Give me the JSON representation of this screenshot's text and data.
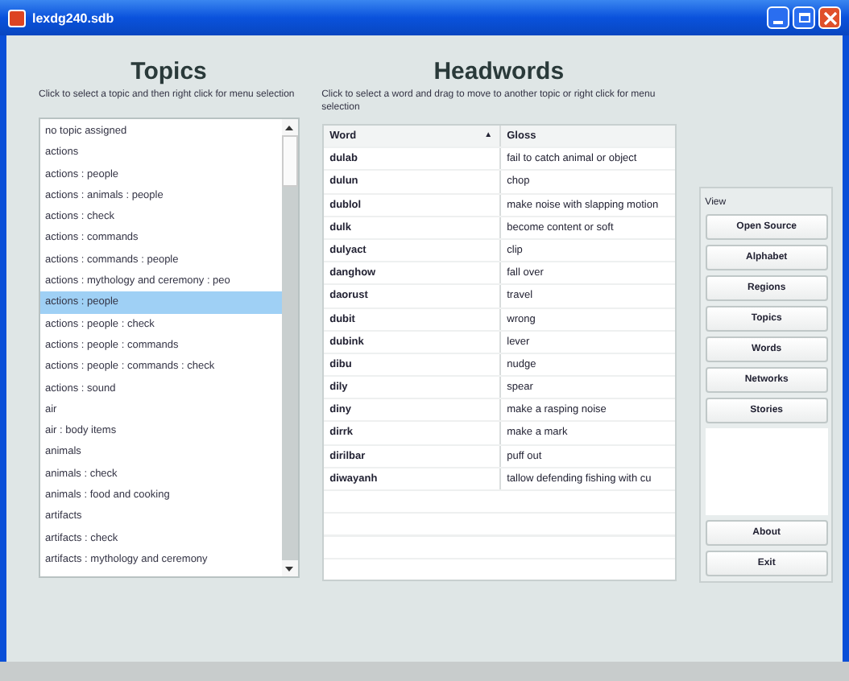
{
  "window": {
    "title": "lexdg240.sdb"
  },
  "topics": {
    "title": "Topics",
    "hint": "Click to select a topic and then right click for menu selection",
    "items": [
      {
        "label": "no topic assigned",
        "selected": false
      },
      {
        "label": "actions",
        "selected": false
      },
      {
        "label": "actions : people",
        "selected": false
      },
      {
        "label": "actions : animals : people",
        "selected": false
      },
      {
        "label": "actions : check",
        "selected": false
      },
      {
        "label": "actions : commands",
        "selected": false
      },
      {
        "label": "actions : commands : people",
        "selected": false
      },
      {
        "label": "actions : mythology and ceremony : peo",
        "selected": false
      },
      {
        "label": "actions : people",
        "selected": true
      },
      {
        "label": "actions : people : check",
        "selected": false
      },
      {
        "label": "actions : people : commands",
        "selected": false
      },
      {
        "label": "actions : people : commands : check",
        "selected": false
      },
      {
        "label": "actions : sound",
        "selected": false
      },
      {
        "label": "air",
        "selected": false
      },
      {
        "label": "air : body items",
        "selected": false
      },
      {
        "label": "animals",
        "selected": false
      },
      {
        "label": "animals : check",
        "selected": false
      },
      {
        "label": "animals : food and cooking",
        "selected": false
      },
      {
        "label": "artifacts",
        "selected": false
      },
      {
        "label": "artifacts : check",
        "selected": false
      },
      {
        "label": "artifacts : mythology and ceremony",
        "selected": false
      }
    ]
  },
  "headwords": {
    "title": "Headwords",
    "hint": "Click to select a word and drag to move to another topic or right click for menu selection",
    "columns": [
      "Word",
      "Gloss"
    ],
    "sort_icon": "▲",
    "rows": [
      [
        "dulab",
        "fail to catch animal or object"
      ],
      [
        "dulun",
        "chop"
      ],
      [
        "dublol",
        "make noise with slapping motion"
      ],
      [
        "dulk",
        "become content or soft"
      ],
      [
        "dulyact",
        "clip"
      ],
      [
        "danghow",
        "fall over"
      ],
      [
        "daorust",
        "travel"
      ],
      [
        "dubit",
        "wrong"
      ],
      [
        "dubink",
        "lever"
      ],
      [
        "dibu",
        "nudge"
      ],
      [
        "dily",
        "spear"
      ],
      [
        "diny",
        "make a rasping noise"
      ],
      [
        "dirrk",
        "make a mark"
      ],
      [
        "dirilbar",
        "puff out"
      ],
      [
        "diwayanh",
        "tallow defending fishing with cu"
      ]
    ]
  },
  "view": {
    "label": "View",
    "buttons": [
      "Open Source",
      "Alphabet",
      "Regions",
      "Topics",
      "Words",
      "Networks",
      "Stories"
    ],
    "bottom_buttons": [
      "About",
      "Exit"
    ]
  }
}
